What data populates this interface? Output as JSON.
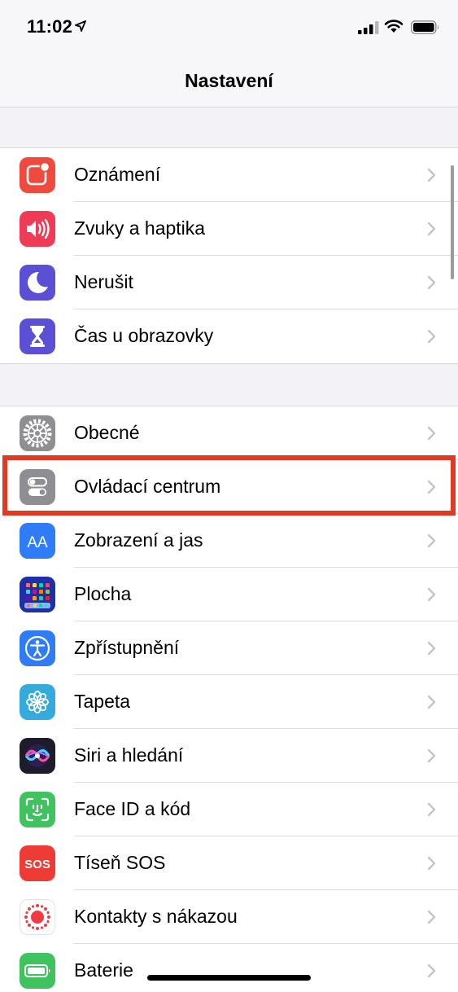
{
  "status_bar": {
    "time": "11:02",
    "icons": [
      "location-arrow-icon",
      "cellular-signal-icon",
      "wifi-icon",
      "battery-icon"
    ]
  },
  "nav": {
    "title": "Nastavení"
  },
  "groups": [
    {
      "items": [
        {
          "label": "Oznámení",
          "icon": "notifications-icon",
          "color": "#f04a3f"
        },
        {
          "label": "Zvuky a haptika",
          "icon": "speaker-icon",
          "color": "#ef3b56"
        },
        {
          "label": "Nerušit",
          "icon": "moon-icon",
          "color": "#5b4fd6"
        },
        {
          "label": "Čas u obrazovky",
          "icon": "hourglass-icon",
          "color": "#5b4fd6"
        }
      ]
    },
    {
      "items": [
        {
          "label": "Obecné",
          "icon": "gear-icon",
          "color": "#8e8e93"
        },
        {
          "label": "Ovládací centrum",
          "icon": "toggles-icon",
          "color": "#8e8e93",
          "highlighted": true
        },
        {
          "label": "Zobrazení a jas",
          "icon": "text-size-icon",
          "color": "#2f7cf6"
        },
        {
          "label": "Plocha",
          "icon": "home-screen-grid-icon",
          "color": "#2b47d8"
        },
        {
          "label": "Zpřístupnění",
          "icon": "accessibility-icon",
          "color": "#2f7cf6"
        },
        {
          "label": "Tapeta",
          "icon": "wallpaper-flower-icon",
          "color": "#35aadc"
        },
        {
          "label": "Siri a hledání",
          "icon": "siri-icon",
          "color": "#1c1c2a"
        },
        {
          "label": "Face ID a kód",
          "icon": "face-id-icon",
          "color": "#3fc35f"
        },
        {
          "label": "Tíseň SOS",
          "icon": "sos-icon",
          "color": "#ee3b35"
        },
        {
          "label": "Kontakty s nákazou",
          "icon": "exposure-notification-icon",
          "color": "#ffffff"
        },
        {
          "label": "Baterie",
          "icon": "battery-icon",
          "color": "#3fc35f"
        }
      ]
    }
  ],
  "sos_icon_text": "SOS",
  "text_size_icon_text": "AA"
}
